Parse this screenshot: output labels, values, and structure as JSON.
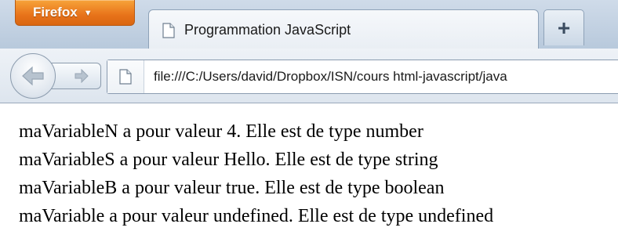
{
  "browser": {
    "menu_button": "Firefox",
    "menu_arrow": "▼",
    "new_tab_label": "+"
  },
  "tabs": [
    {
      "title": "Programmation JavaScript",
      "icon": "page-icon",
      "active": true
    }
  ],
  "navbar": {
    "back_icon": "back-arrow-icon",
    "forward_icon": "forward-arrow-icon",
    "url": "file:///C:/Users/david/Dropbox/ISN/cours html-javascript/java"
  },
  "content": {
    "lines": [
      "maVariableN a pour valeur 4. Elle est de type number",
      "maVariableS a pour valeur Hello. Elle est de type string",
      "maVariableB a pour valeur true. Elle est de type boolean",
      "maVariable a pour valeur undefined. Elle est de type undefined"
    ]
  },
  "colors": {
    "firefox_button": "#e8731a",
    "tabstrip": "#c4d3e3"
  }
}
